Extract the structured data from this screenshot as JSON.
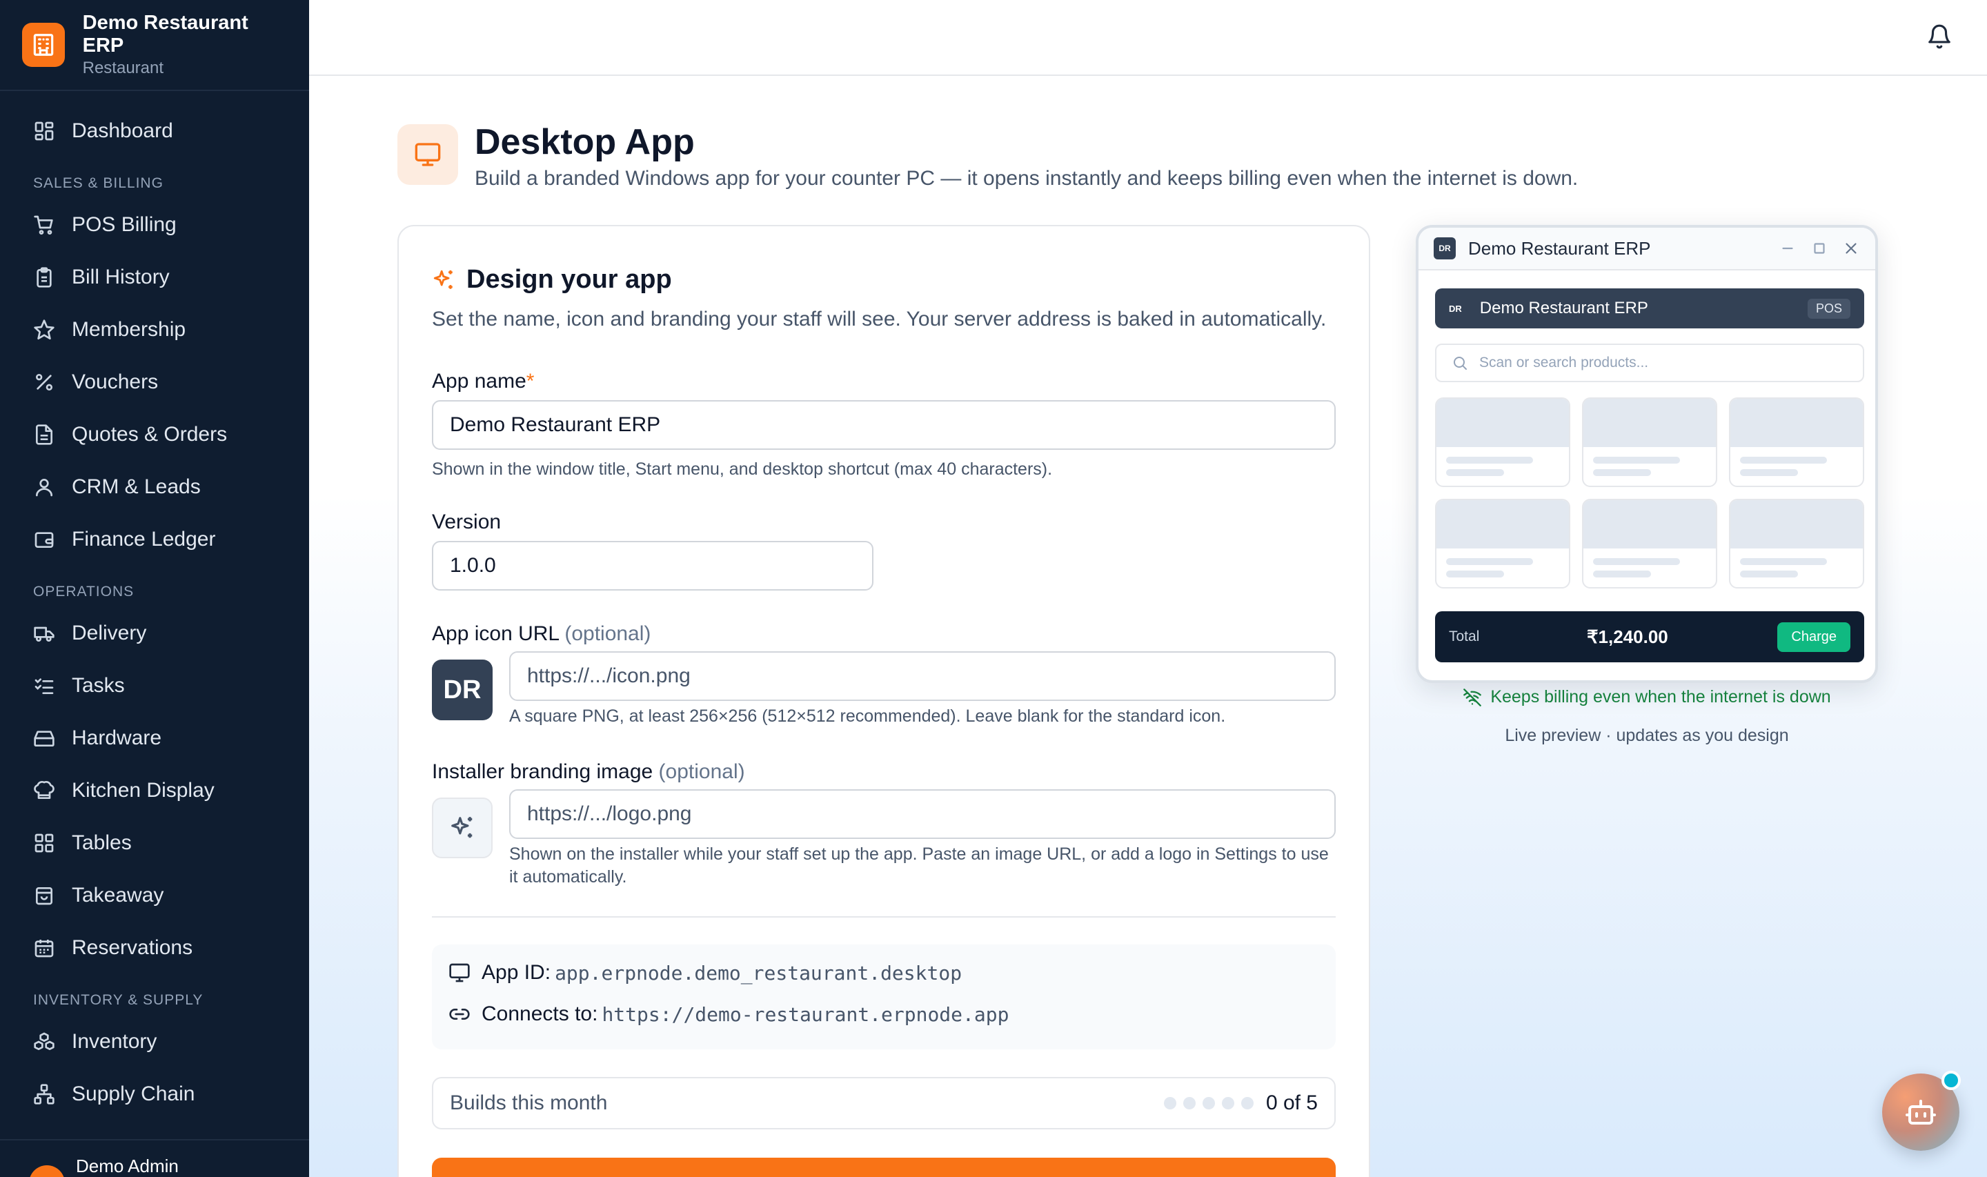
{
  "brand": {
    "name": "Demo Restaurant ERP",
    "subtitle": "Restaurant"
  },
  "sidebar": {
    "top": [
      {
        "label": "Dashboard",
        "icon": "dashboard-icon"
      }
    ],
    "sections": [
      {
        "title": "SALES & BILLING",
        "items": [
          {
            "label": "POS Billing",
            "icon": "cart-icon"
          },
          {
            "label": "Bill History",
            "icon": "clipboard-icon"
          },
          {
            "label": "Membership",
            "icon": "star-icon"
          },
          {
            "label": "Vouchers",
            "icon": "percent-icon"
          },
          {
            "label": "Quotes & Orders",
            "icon": "document-icon"
          },
          {
            "label": "CRM & Leads",
            "icon": "user-icon"
          },
          {
            "label": "Finance Ledger",
            "icon": "wallet-icon"
          }
        ]
      },
      {
        "title": "OPERATIONS",
        "items": [
          {
            "label": "Delivery",
            "icon": "truck-icon"
          },
          {
            "label": "Tasks",
            "icon": "checklist-icon"
          },
          {
            "label": "Hardware",
            "icon": "hard-drive-icon"
          },
          {
            "label": "Kitchen Display",
            "icon": "chef-hat-icon"
          },
          {
            "label": "Tables",
            "icon": "grid-icon"
          },
          {
            "label": "Takeaway",
            "icon": "bag-icon"
          },
          {
            "label": "Reservations",
            "icon": "calendar-icon"
          }
        ]
      },
      {
        "title": "INVENTORY & SUPPLY",
        "items": [
          {
            "label": "Inventory",
            "icon": "boxes-icon"
          },
          {
            "label": "Supply Chain",
            "icon": "network-icon"
          }
        ]
      }
    ],
    "user": {
      "name": "Demo Admin"
    }
  },
  "page": {
    "title": "Desktop App",
    "subtitle": "Build a branded Windows app for your counter PC — it opens instantly and keeps billing even when the internet is down."
  },
  "form": {
    "title": "Design your app",
    "description": "Set the name, icon and branding your staff will see. Your server address is baked in automatically.",
    "app_name": {
      "label": "App name",
      "required_mark": "*",
      "value": "Demo Restaurant ERP",
      "help": "Shown in the window title, Start menu, and desktop shortcut (max 40 characters)."
    },
    "version": {
      "label": "Version",
      "value": "1.0.0"
    },
    "icon_url": {
      "label": "App icon URL",
      "optional": "(optional)",
      "placeholder": "https://.../icon.png",
      "initials": "DR",
      "help": "A square PNG, at least 256×256 (512×512 recommended). Leave blank for the standard icon."
    },
    "branding": {
      "label": "Installer branding image",
      "optional": "(optional)",
      "placeholder": "https://.../logo.png",
      "help": "Shown on the installer while your staff set up the app. Paste an image URL, or add a logo in Settings to use it automatically."
    },
    "info": {
      "app_id_label": "App ID:",
      "app_id": "app.erpnode.demo_restaurant.desktop",
      "connects_label": "Connects to:",
      "connects": "https://demo-restaurant.erpnode.app"
    },
    "builds": {
      "label": "Builds this month",
      "used": 0,
      "limit": 5,
      "count_text": "0 of 5"
    }
  },
  "preview": {
    "window_title": "Demo Restaurant ERP",
    "badge": "DR",
    "app_name": "Demo Restaurant ERP",
    "pos_tag": "POS",
    "search_placeholder": "Scan or search products...",
    "total_label": "Total",
    "total_value": "₹1,240.00",
    "charge_label": "Charge",
    "offline_note": "Keeps billing even when the internet is down",
    "caption": "Live preview · updates as you design"
  },
  "colors": {
    "accent": "#f97316",
    "sidebar_bg": "#0f1d30",
    "success": "#10b981",
    "offline_text": "#15803d"
  }
}
